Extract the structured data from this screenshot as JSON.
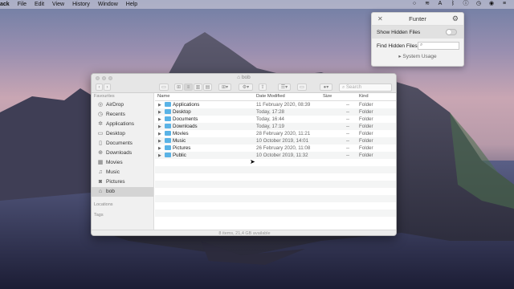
{
  "menubar": {
    "app_name": "ack",
    "items": [
      "File",
      "Edit",
      "View",
      "History",
      "Window",
      "Help"
    ]
  },
  "funter": {
    "title": "Funter",
    "show_hidden_label": "Show Hidden Files",
    "find_hidden_label": "Find Hidden Files",
    "system_usage_label": "System Usage"
  },
  "finder": {
    "title": "bob",
    "search_placeholder": "Search",
    "sidebar": {
      "favourites_heading": "Favourites",
      "items": [
        {
          "label": "AirDrop",
          "icon": "airdrop-icon"
        },
        {
          "label": "Recents",
          "icon": "clock-icon"
        },
        {
          "label": "Applications",
          "icon": "applications-icon"
        },
        {
          "label": "Desktop",
          "icon": "desktop-icon"
        },
        {
          "label": "Documents",
          "icon": "document-icon"
        },
        {
          "label": "Downloads",
          "icon": "download-icon"
        },
        {
          "label": "Movies",
          "icon": "film-icon"
        },
        {
          "label": "Music",
          "icon": "music-icon"
        },
        {
          "label": "Pictures",
          "icon": "camera-icon"
        },
        {
          "label": "bob",
          "icon": "home-icon"
        }
      ],
      "locations_heading": "Locations",
      "tags_heading": "Tags"
    },
    "columns": {
      "name": "Name",
      "date": "Date Modified",
      "size": "Size",
      "kind": "Kind"
    },
    "rows": [
      {
        "name": "Applications",
        "date": "11 February 2020, 08:39",
        "size": "--",
        "kind": "Folder"
      },
      {
        "name": "Desktop",
        "date": "Today, 17:28",
        "size": "--",
        "kind": "Folder"
      },
      {
        "name": "Documents",
        "date": "Today, 16:44",
        "size": "--",
        "kind": "Folder"
      },
      {
        "name": "Downloads",
        "date": "Today, 17:19",
        "size": "--",
        "kind": "Folder"
      },
      {
        "name": "Movies",
        "date": "28 February 2020, 11:21",
        "size": "--",
        "kind": "Folder"
      },
      {
        "name": "Music",
        "date": "10 October 2019, 14:01",
        "size": "--",
        "kind": "Folder"
      },
      {
        "name": "Pictures",
        "date": "26 February 2020, 11:08",
        "size": "--",
        "kind": "Folder"
      },
      {
        "name": "Public",
        "date": "10 October 2019, 11:32",
        "size": "--",
        "kind": "Folder"
      }
    ],
    "status": "8 items, 21,4 GB available"
  }
}
